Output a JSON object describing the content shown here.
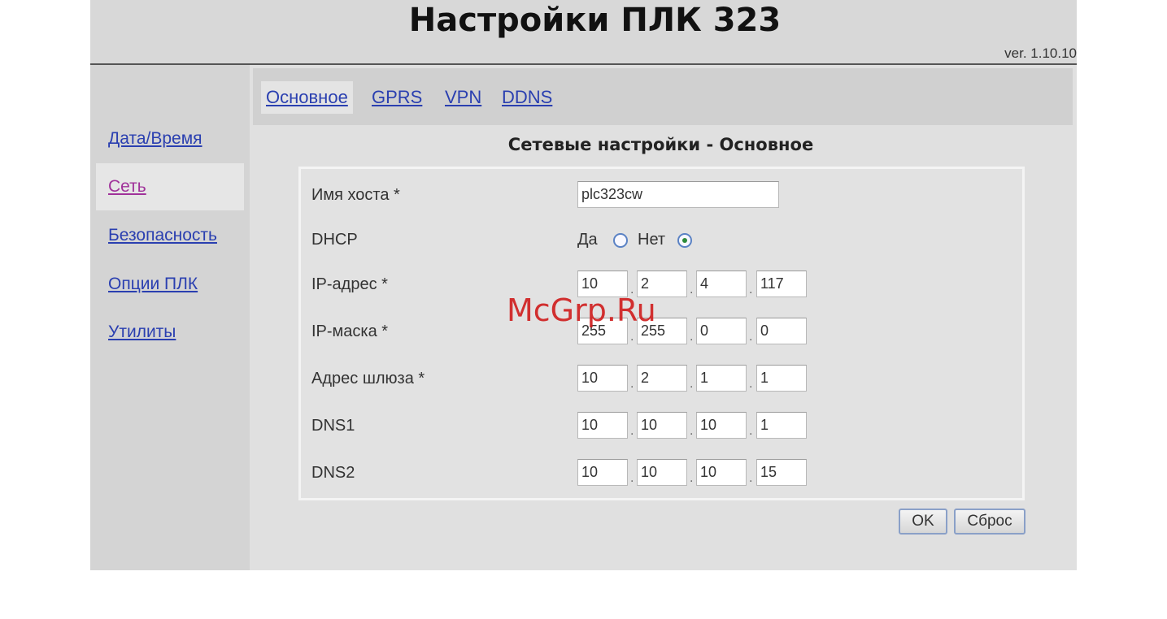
{
  "header": {
    "title": "Настройки ПЛК 323",
    "version": "ver. 1.10.10"
  },
  "sidebar": {
    "items": [
      {
        "label": "Дата/Время",
        "active": false
      },
      {
        "label": "Сеть",
        "active": true
      },
      {
        "label": "Безопасность",
        "active": false
      },
      {
        "label": "Опции ПЛК",
        "active": false
      },
      {
        "label": "Утилиты",
        "active": false
      }
    ]
  },
  "tabs": [
    {
      "label": "Основное",
      "active": true
    },
    {
      "label": "GPRS",
      "active": false
    },
    {
      "label": "VPN",
      "active": false
    },
    {
      "label": "DDNS",
      "active": false
    }
  ],
  "section_title": "Сетевые настройки - Основное",
  "form": {
    "hostname": {
      "label": "Имя хоста *",
      "value": "plc323cw"
    },
    "dhcp": {
      "label": "DHCP",
      "yes_label": "Да",
      "no_label": "Нет",
      "selected": "Нет"
    },
    "ip": {
      "label": "IP-адрес *",
      "octets": [
        "10",
        "2",
        "4",
        "117"
      ]
    },
    "mask": {
      "label": "IP-маска *",
      "octets": [
        "255",
        "255",
        "0",
        "0"
      ]
    },
    "gateway": {
      "label": "Адрес шлюза *",
      "octets": [
        "10",
        "2",
        "1",
        "1"
      ]
    },
    "dns1": {
      "label": "DNS1",
      "octets": [
        "10",
        "10",
        "10",
        "1"
      ]
    },
    "dns2": {
      "label": "DNS2",
      "octets": [
        "10",
        "10",
        "10",
        "15"
      ]
    }
  },
  "buttons": {
    "ok": "OK",
    "reset": "Сброс"
  },
  "watermark": "McGrp.Ru",
  "colors": {
    "link": "#2a3fb0",
    "active_link": "#a0329a",
    "watermark": "#d02020"
  }
}
